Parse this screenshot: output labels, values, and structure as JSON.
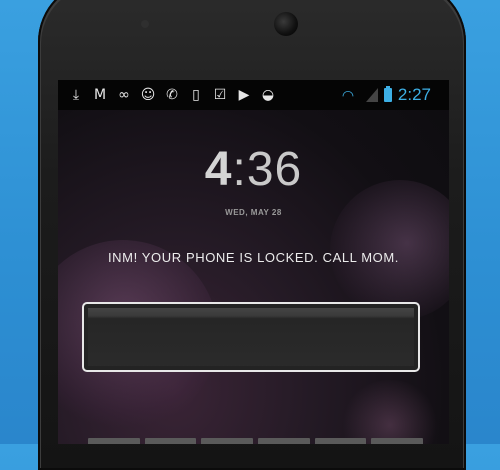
{
  "status_bar": {
    "notification_icons": [
      {
        "name": "download-icon",
        "glyph": "⤓"
      },
      {
        "name": "gmail-icon",
        "glyph": "M"
      },
      {
        "name": "voicemail-icon",
        "glyph": "∞"
      },
      {
        "name": "chat-icon",
        "glyph": "☺"
      },
      {
        "name": "missed-call-icon",
        "glyph": "✆"
      },
      {
        "name": "phone-update-icon",
        "glyph": "▯"
      },
      {
        "name": "task-check-icon",
        "glyph": "☑"
      },
      {
        "name": "play-store-icon",
        "glyph": "▶"
      },
      {
        "name": "android-icon",
        "glyph": "◒"
      }
    ],
    "clock": "2:27",
    "accent_color": "#3db0e6"
  },
  "lock_screen": {
    "time_hour": "4",
    "time_sep": ":",
    "time_minutes": "36",
    "date": "WED, MAY 28",
    "message": "INM! YOUR PHONE IS LOCKED. CALL MOM.",
    "pin_value": ""
  }
}
